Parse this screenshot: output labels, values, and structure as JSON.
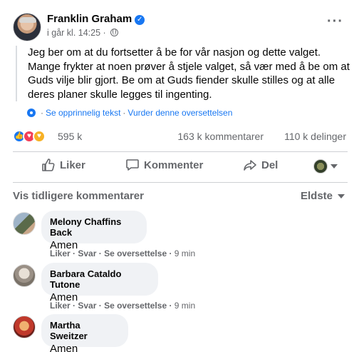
{
  "post": {
    "author": "Franklin Graham",
    "timestamp": "i går kl. 14:25 ·",
    "text": "Jeg ber om at du fortsetter å be for vår nasjon og dette valget. Mange frykter at noen prøver å stjele valget, så vær med å be om at Guds vilje blir gjort. Be om at Guds fiender skulle stilles og at alle deres planer skulle legges til ingenting.",
    "see_original": "Se opprinnelig tekst",
    "rate_translation": "Vurder denne oversettelsen"
  },
  "stats": {
    "reactions": "595 k",
    "comments": "163 k kommentarer",
    "shares": "110 k delinger"
  },
  "actions": {
    "like": "Liker",
    "comment": "Kommenter",
    "share": "Del"
  },
  "comments_section": {
    "previous": "Vis tidligere kommentarer",
    "sort": "Eldste"
  },
  "comments": [
    {
      "name": "Melony Chaffins Back",
      "text": "Amen",
      "like": "Liker",
      "reply": "Svar",
      "translate": "Se oversettelse",
      "time": "9 min"
    },
    {
      "name": "Barbara Cataldo Tutone",
      "text": "Amen",
      "like": "Liker",
      "reply": "Svar",
      "translate": "Se oversettelse",
      "time": "9 min"
    },
    {
      "name": "Martha Sweitzer",
      "text": "Amen"
    }
  ],
  "colors": {
    "accent": "#1877f2",
    "muted_text": "#65676b",
    "bubble": "#f0f2f5"
  },
  "icons": [
    "verified-badge-icon",
    "globe-icon",
    "more-options-icon",
    "gear-icon",
    "like-reaction-icon",
    "love-reaction-icon",
    "care-reaction-icon",
    "thumbs-up-icon",
    "comment-icon",
    "share-icon",
    "chevron-down-icon"
  ]
}
